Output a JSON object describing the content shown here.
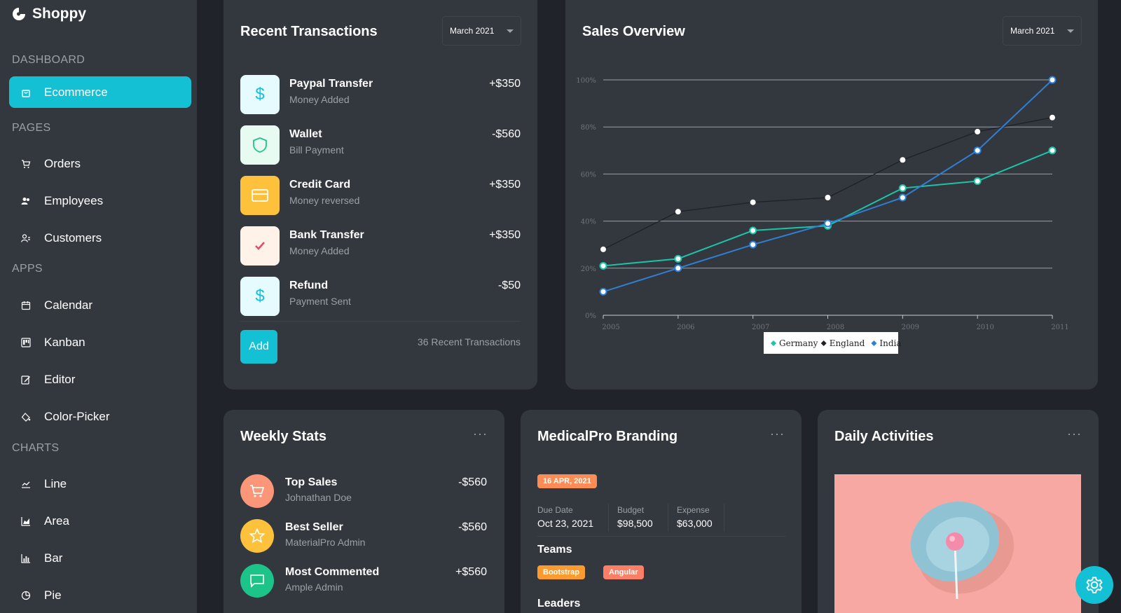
{
  "brand": {
    "name": "Shoppy"
  },
  "sidebar": {
    "sections": [
      {
        "title": "DASHBOARD",
        "items": [
          {
            "label": "Ecommerce",
            "icon": "shopping-bag-icon",
            "active": true
          }
        ]
      },
      {
        "title": "PAGES",
        "items": [
          {
            "label": "Orders",
            "icon": "cart-icon"
          },
          {
            "label": "Employees",
            "icon": "employees-icon"
          },
          {
            "label": "Customers",
            "icon": "customers-icon"
          }
        ]
      },
      {
        "title": "APPS",
        "items": [
          {
            "label": "Calendar",
            "icon": "calendar-icon"
          },
          {
            "label": "Kanban",
            "icon": "kanban-icon"
          },
          {
            "label": "Editor",
            "icon": "edit-icon"
          },
          {
            "label": "Color-Picker",
            "icon": "color-picker-icon"
          }
        ]
      },
      {
        "title": "CHARTS",
        "items": [
          {
            "label": "Line",
            "icon": "line-chart-icon"
          },
          {
            "label": "Area",
            "icon": "area-chart-icon"
          },
          {
            "label": "Bar",
            "icon": "bar-chart-icon"
          },
          {
            "label": "Pie",
            "icon": "pie-chart-icon"
          }
        ]
      }
    ]
  },
  "recent_transactions": {
    "title": "Recent Transactions",
    "period": "March 2021",
    "items": [
      {
        "title": "Paypal Transfer",
        "subtitle": "Money Added",
        "amount": "+$350",
        "icon": "dollar-icon"
      },
      {
        "title": "Wallet",
        "subtitle": "Bill Payment",
        "amount": "-$560",
        "icon": "shield-icon"
      },
      {
        "title": "Credit Card",
        "subtitle": "Money reversed",
        "amount": "+$350",
        "icon": "credit-card-icon"
      },
      {
        "title": "Bank Transfer",
        "subtitle": "Money Added",
        "amount": "+$350",
        "icon": "check-icon"
      },
      {
        "title": "Refund",
        "subtitle": "Payment Sent",
        "amount": "-$50",
        "icon": "dollar-icon"
      }
    ],
    "add_label": "Add",
    "count_text": "36 Recent Transactions"
  },
  "sales_overview": {
    "title": "Sales Overview",
    "period": "March 2021"
  },
  "chart_data": {
    "type": "line",
    "title": "Sales Overview",
    "x": [
      "2005",
      "2006",
      "2007",
      "2008",
      "2009",
      "2010",
      "2011"
    ],
    "y_ticks": [
      "0%",
      "20%",
      "40%",
      "60%",
      "80%",
      "100%"
    ],
    "ylim": [
      0,
      100
    ],
    "grid": true,
    "legend": "bottom",
    "series": [
      {
        "name": "Germany",
        "color": "#1cc4a8",
        "values": [
          21,
          24,
          36,
          38,
          54,
          57,
          70
        ]
      },
      {
        "name": "England",
        "color": "#1e2126",
        "values": [
          28,
          44,
          48,
          50,
          66,
          78,
          84
        ]
      },
      {
        "name": "India",
        "color": "#2f7fd6",
        "values": [
          10,
          20,
          30,
          39,
          50,
          70,
          100
        ]
      }
    ]
  },
  "weekly_stats": {
    "title": "Weekly Stats",
    "items": [
      {
        "title": "Top Sales",
        "subtitle": "Johnathan Doe",
        "amount": "-$560",
        "icon": "cart-icon"
      },
      {
        "title": "Best Seller",
        "subtitle": "MaterialPro Admin",
        "amount": "-$560",
        "icon": "star-icon"
      },
      {
        "title": "Most Commented",
        "subtitle": "Ample Admin",
        "amount": "+$560",
        "icon": "chat-icon"
      }
    ]
  },
  "branding": {
    "title": "MedicalPro Branding",
    "date_badge": "16 APR, 2021",
    "due_date_label": "Due Date",
    "due_date": "Oct 23, 2021",
    "budget_label": "Budget",
    "budget": "$98,500",
    "expense_label": "Expense",
    "expense": "$63,000",
    "teams_label": "Teams",
    "teams": [
      "Bootstrap",
      "Angular"
    ],
    "leaders_label": "Leaders"
  },
  "daily_activities": {
    "title": "Daily Activities"
  },
  "colors": {
    "accent": "#14c1d4",
    "card": "#33373e",
    "background": "#20232a"
  }
}
